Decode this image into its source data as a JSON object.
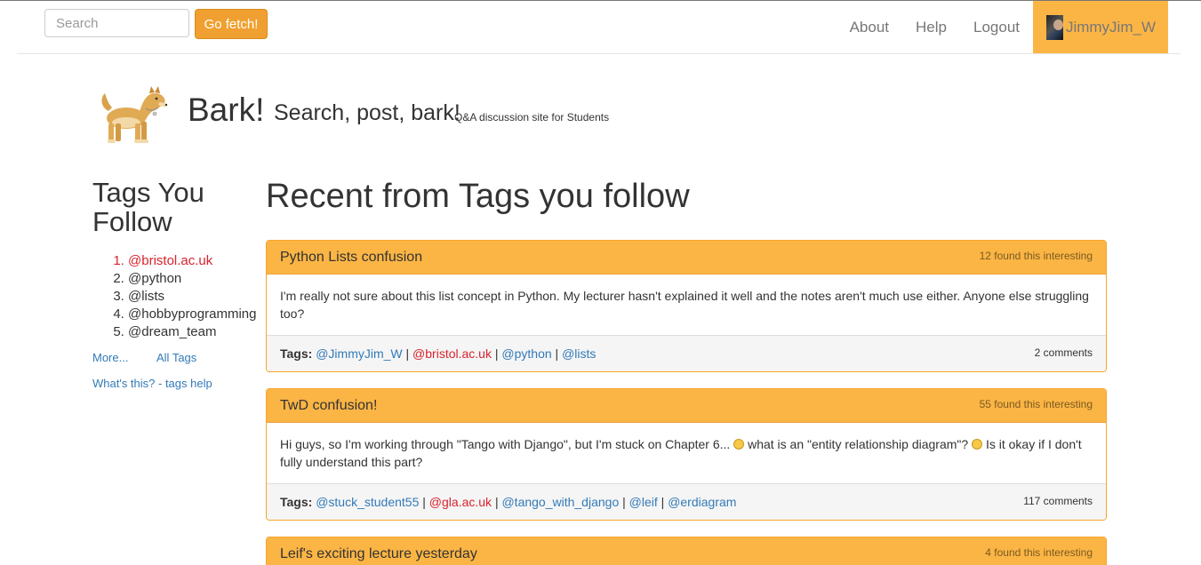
{
  "navbar": {
    "search_placeholder": "Search",
    "fetch_label": "Go fetch!",
    "links": [
      "About",
      "Help",
      "Logout"
    ],
    "username": "JimmyJim_W",
    "accent_color": "#fbb545"
  },
  "brand": {
    "title": "Bark!",
    "tagline": "Search, post, bark!",
    "subtitle": "Q&A discussion site for Students",
    "logo_icon": "dog-logo"
  },
  "sidebar": {
    "heading": "Tags You Follow",
    "tags": [
      "@bristol.ac.uk",
      "@python",
      "@lists",
      "@hobbyprogramming",
      "@dream_team"
    ],
    "more_label": "More...",
    "all_tags_label": "All Tags",
    "help_label": "What's this? - tags help"
  },
  "main": {
    "heading": "Recent from Tags you follow",
    "tags_label": "Tags:",
    "posts": [
      {
        "title": "Python Lists confusion",
        "interest": "12 found this interesting",
        "body": "I'm really not sure about this list concept in Python. My lecturer hasn't explained it well and the notes aren't much use either. Anyone else struggling too?",
        "tags": [
          "@JimmyJim_W",
          "@bristol.ac.uk",
          "@python",
          "@lists"
        ],
        "comments": "2 comments"
      },
      {
        "title": "TwD confusion!",
        "interest": "55 found this interesting",
        "body_part1": "Hi guys, so I'm working through \"Tango with Django\", but I'm stuck on Chapter 6...",
        "body_part2": "what is an \"entity relationship diagram\"?",
        "body_part3": "Is it okay if I don't fully understand this part?",
        "tags": [
          "@stuck_student55",
          "@gla.ac.uk",
          "@tango_with_django",
          "@leif",
          "@erdiagram"
        ],
        "comments": "117 comments"
      },
      {
        "title": "Leif's exciting lecture yesterday",
        "interest": "4 found this interesting"
      }
    ]
  }
}
